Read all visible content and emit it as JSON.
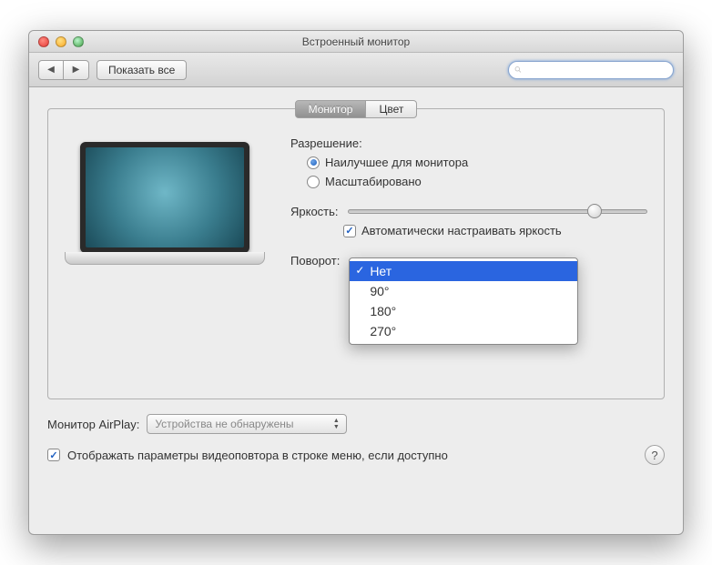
{
  "window": {
    "title": "Встроенный монитор"
  },
  "toolbar": {
    "show_all": "Показать все",
    "search_placeholder": ""
  },
  "tabs": {
    "monitor": "Монитор",
    "color": "Цвет"
  },
  "resolution": {
    "label": "Разрешение:",
    "best": "Наилучшее для монитора",
    "scaled": "Масштабировано"
  },
  "brightness": {
    "label": "Яркость:",
    "auto": "Автоматически настраивать яркость"
  },
  "rotation": {
    "label": "Поворот:",
    "options": [
      "Нет",
      "90°",
      "180°",
      "270°"
    ]
  },
  "airplay": {
    "label": "Монитор AirPlay:",
    "value": "Устройства не обнаружены"
  },
  "footer": {
    "show_mirror": "Отображать параметры видеоповтора в строке меню, если доступно",
    "help": "?"
  }
}
